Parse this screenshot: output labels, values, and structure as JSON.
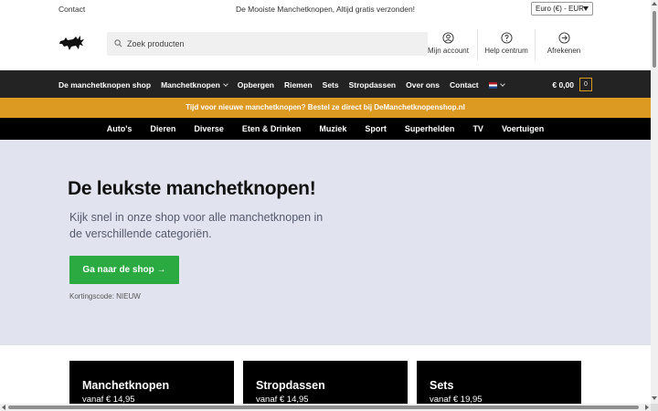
{
  "topbar": {
    "contact_label": "Contact",
    "promo_text": "De Mooiste Manchetknopen, Altijd gratis verzonden!",
    "currency_selected": "Euro (€) - EUR"
  },
  "header": {
    "logo_icon": "bull-logo-icon",
    "search": {
      "placeholder": "Zoek producten",
      "value": ""
    },
    "links": [
      {
        "label": "Mijn account",
        "icon": "user-icon"
      },
      {
        "label": "Help centrum",
        "icon": "help-icon"
      },
      {
        "label": "Afrekenen",
        "icon": "arrow-right-circle-icon"
      }
    ]
  },
  "mainnav": {
    "items": [
      {
        "label": "De manchetknopen shop"
      },
      {
        "label": "Manchetknopen",
        "has_dropdown": true
      },
      {
        "label": "Opbergen"
      },
      {
        "label": "Riemen"
      },
      {
        "label": "Sets"
      },
      {
        "label": "Stropdassen"
      },
      {
        "label": "Over ons"
      },
      {
        "label": "Contact"
      }
    ],
    "language_icon": "dutch-flag-icon",
    "cart_total": "€ 0,00",
    "cart_count": "0"
  },
  "promo_band": {
    "text": "Tijd voor nieuwe manchetknopen? Bestel ze direct bij DeManchetknopenshop.nl",
    "color": "#dd9a22"
  },
  "categories": [
    "Auto's",
    "Dieren",
    "Diverse",
    "Eten & Drinken",
    "Muziek",
    "Sport",
    "Superhelden",
    "TV",
    "Voertuigen"
  ],
  "hero": {
    "title": "De leukste manchetknopen!",
    "subtitle": "Kijk snel in onze shop voor alle manchetknopen in de verschillende categoriën.",
    "button_label": "Ga naar de shop →",
    "discount_text": "Kortingscode: NIEUW",
    "button_color": "#2aaa41",
    "background": "#e1e4ef"
  },
  "cards": [
    {
      "title": "Manchetknopen",
      "price": "vanaf € 14,95"
    },
    {
      "title": "Stropdassen",
      "price": "vanaf € 14,95"
    },
    {
      "title": "Sets",
      "price": "vanaf € 19,95"
    }
  ]
}
